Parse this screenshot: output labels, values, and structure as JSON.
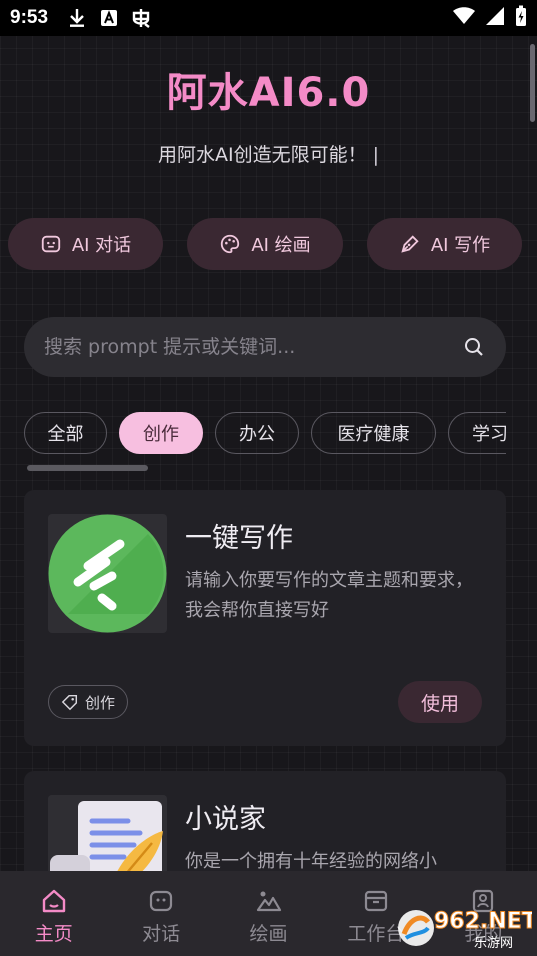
{
  "status_bar": {
    "time": "9:53"
  },
  "header": {
    "title": "阿水AI6.0",
    "subtitle": "用阿水AI创造无限可能！",
    "caret": "|"
  },
  "quick_actions": [
    {
      "label": "AI 对话",
      "icon": "chat-bubble-icon"
    },
    {
      "label": "AI 绘画",
      "icon": "palette-icon"
    },
    {
      "label": "AI 写作",
      "icon": "pen-icon"
    }
  ],
  "search": {
    "placeholder": "搜索 prompt 提示或关键词...",
    "value": ""
  },
  "categories": {
    "items": [
      "全部",
      "创作",
      "办公",
      "医疗健康",
      "学习"
    ],
    "selected": "创作"
  },
  "cards": [
    {
      "title": "一键写作",
      "description": "请输入你要写作的文章主题和要求，我会帮你直接写好",
      "tag": "创作",
      "action": "使用",
      "icon": "quill-logo-icon"
    },
    {
      "title": "小说家",
      "description": "你是一个拥有十年经验的网络小",
      "icon": "scroll-feather-icon"
    }
  ],
  "bottom_nav": {
    "items": [
      {
        "label": "主页",
        "icon": "home-icon"
      },
      {
        "label": "对话",
        "icon": "chat-icon"
      },
      {
        "label": "绘画",
        "icon": "mountain-icon"
      },
      {
        "label": "工作台",
        "icon": "briefcase-icon"
      },
      {
        "label": "我的",
        "icon": "profile-icon"
      }
    ],
    "active": "主页"
  },
  "watermark": {
    "logo": "962.NET",
    "sub": "乐游网"
  },
  "colors": {
    "accent": "#f48bc7",
    "chip_active": "#f7bfe0",
    "background": "#18171b",
    "card": "#222126"
  }
}
